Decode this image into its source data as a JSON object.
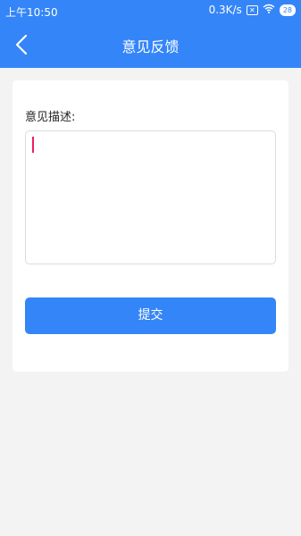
{
  "status_bar": {
    "time": "上午10:50",
    "network_speed": "0.3K/s",
    "sim_icon": "x-box-icon",
    "wifi_icon": "wifi-icon",
    "battery": "28"
  },
  "header": {
    "title": "意见反馈",
    "back_icon": "chevron-left-icon"
  },
  "form": {
    "label": "意见描述:",
    "description_value": "",
    "submit_label": "提交"
  },
  "colors": {
    "primary": "#3485f8",
    "background": "#f3f3f3",
    "caret": "#e91e63"
  }
}
